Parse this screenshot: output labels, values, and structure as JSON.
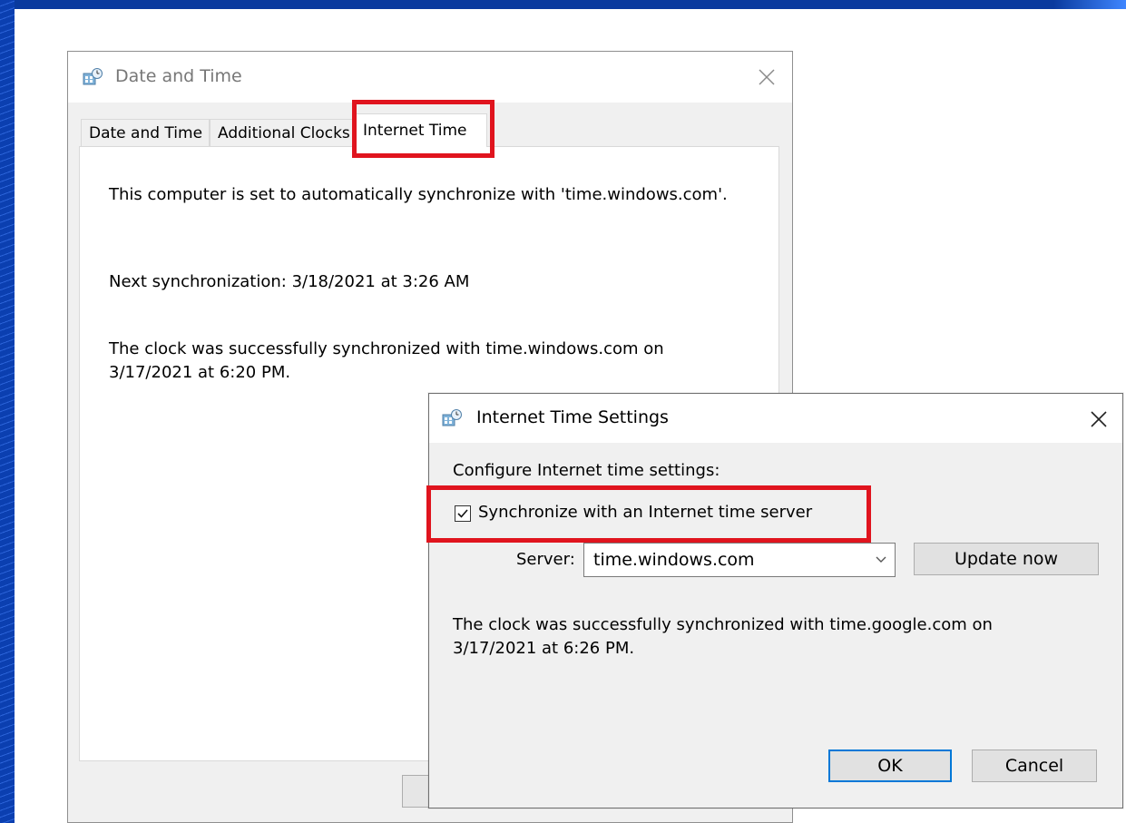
{
  "main_window": {
    "title": "Date and Time",
    "tabs": [
      {
        "label": "Date and Time"
      },
      {
        "label": "Additional Clocks"
      },
      {
        "label": "Internet Time",
        "active": true
      }
    ],
    "panel": {
      "auto_sync_text": "This computer is set to automatically synchronize with 'time.windows.com'.",
      "next_sync_text": "Next synchronization: 3/18/2021 at 3:26 AM",
      "last_sync_line1": "The clock was successfully synchronized with time.windows.com on",
      "last_sync_line2": "3/17/2021 at 6:20 PM."
    }
  },
  "dialog": {
    "title": "Internet Time Settings",
    "heading": "Configure Internet time settings:",
    "sync_checkbox": {
      "label": "Synchronize with an Internet time server",
      "checked": true
    },
    "server_label": "Server:",
    "server_value": "time.windows.com",
    "update_button": "Update now",
    "status_line1": "The clock was successfully synchronized with time.google.com on",
    "status_line2": "3/17/2021 at 6:26 PM.",
    "ok_button": "OK",
    "cancel_button": "Cancel"
  },
  "colors": {
    "highlight": "#e0141e",
    "background_frame": "#0b3fb0",
    "focus_border": "#0078d7"
  },
  "icons": [
    "date-time-app-icon",
    "close-icon",
    "checkbox-checked-icon",
    "chevron-down-icon"
  ]
}
